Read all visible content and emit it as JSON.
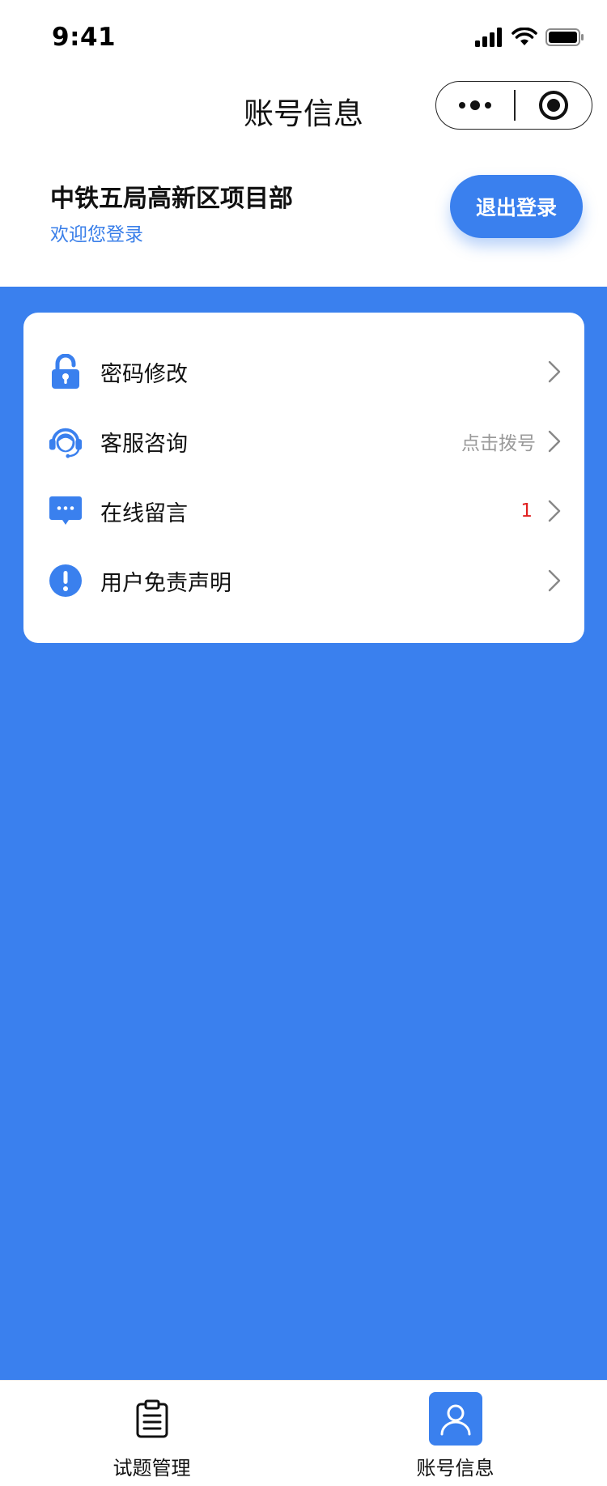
{
  "status_bar": {
    "time": "9:41"
  },
  "nav": {
    "title": "账号信息"
  },
  "account": {
    "name": "中铁五局高新区项目部",
    "welcome": "欢迎您登录",
    "logout_label": "退出登录"
  },
  "menu": {
    "items": [
      {
        "label": "密码修改",
        "icon": "unlock-icon"
      },
      {
        "label": "客服咨询",
        "hint": "点击拨号",
        "icon": "customer-service-icon"
      },
      {
        "label": "在线留言",
        "badge": "1",
        "icon": "message-icon"
      },
      {
        "label": "用户免责声明",
        "icon": "exclamation-icon"
      }
    ]
  },
  "tabs": [
    {
      "label": "试题管理",
      "icon": "clipboard-icon",
      "active": false
    },
    {
      "label": "账号信息",
      "icon": "user-icon",
      "active": true
    }
  ],
  "colors": {
    "accent": "#3a80ee",
    "badge": "#e02020",
    "hint": "#9a9a9a"
  }
}
